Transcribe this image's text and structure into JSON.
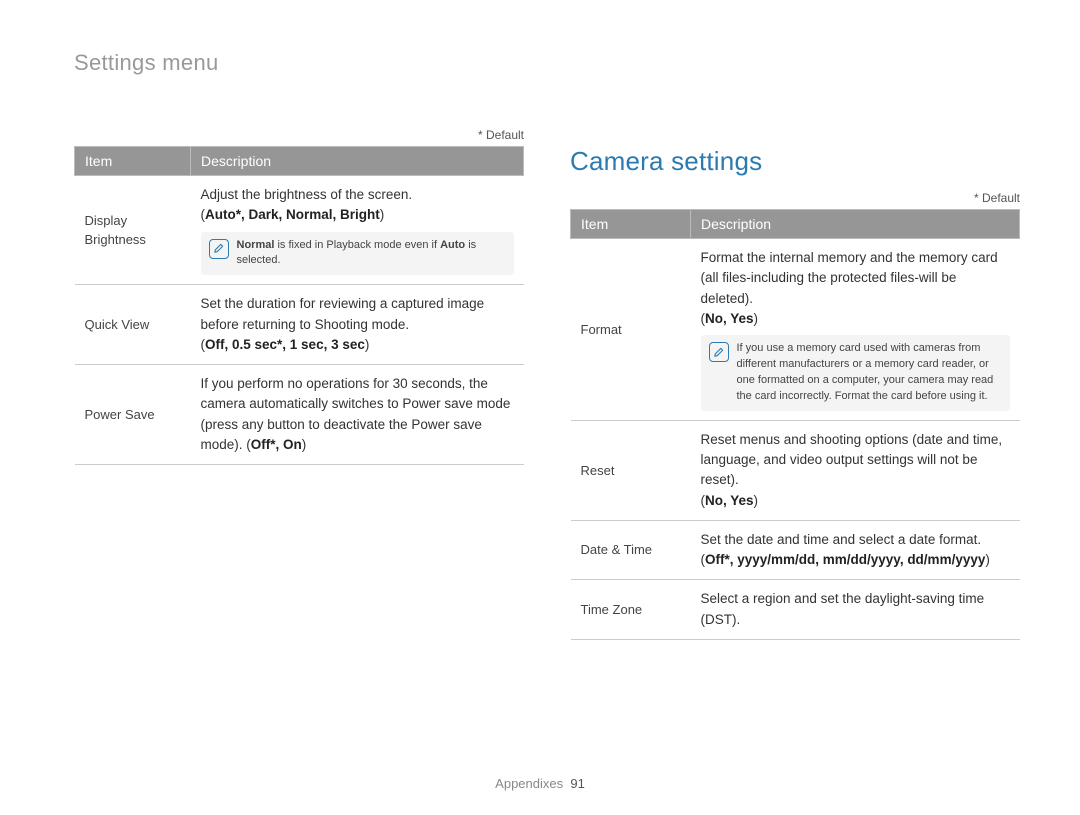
{
  "page_title": "Settings menu",
  "default_label": "* Default",
  "section_heading": "Camera settings",
  "table_headers": {
    "item": "Item",
    "description": "Description"
  },
  "left_table": {
    "rows": [
      {
        "item": "Display Brightness",
        "desc": "Adjust the brightness of the screen.",
        "options_prefix": "(",
        "options": "Auto*, Dark, Normal, Bright",
        "options_suffix": ")",
        "note_pre_bold": "Normal",
        "note_mid": " is fixed in Playback mode even if ",
        "note_post_bold": "Auto",
        "note_tail": " is selected."
      },
      {
        "item": "Quick View",
        "desc": "Set the duration for reviewing a captured image before returning to Shooting mode.",
        "options_prefix": "(",
        "options": "Off, 0.5 sec*, 1 sec, 3 sec",
        "options_suffix": ")"
      },
      {
        "item": "Power Save",
        "desc": "If you perform no operations for 30 seconds, the camera automatically switches to Power save mode (press any button to deactivate the Power save mode). (",
        "options": "Off*, On",
        "options_suffix": ")"
      }
    ]
  },
  "right_table": {
    "rows": [
      {
        "item": "Format",
        "desc": "Format the internal memory and the memory card (all files-including the protected files-will be deleted).",
        "options_prefix": "(",
        "options": "No, Yes",
        "options_suffix": ")",
        "note": "If you use a memory card used with cameras from different manufacturers or a memory card reader, or one formatted on a computer, your camera may read the card incorrectly. Format the card before using it."
      },
      {
        "item": "Reset",
        "desc": "Reset menus and shooting options (date and time, language, and video output settings will not be reset).",
        "options_prefix": "(",
        "options": "No, Yes",
        "options_suffix": ")"
      },
      {
        "item": "Date & Time",
        "desc": "Set the date and time and select a date format.",
        "options_prefix": "(",
        "options": "Off*, yyyy/mm/dd, mm/dd/yyyy, dd/mm/yyyy",
        "options_suffix": ")"
      },
      {
        "item": "Time Zone",
        "desc": "Select a region and set the daylight-saving time (DST)."
      }
    ]
  },
  "footer": {
    "label": "Appendixes",
    "page": "91"
  }
}
